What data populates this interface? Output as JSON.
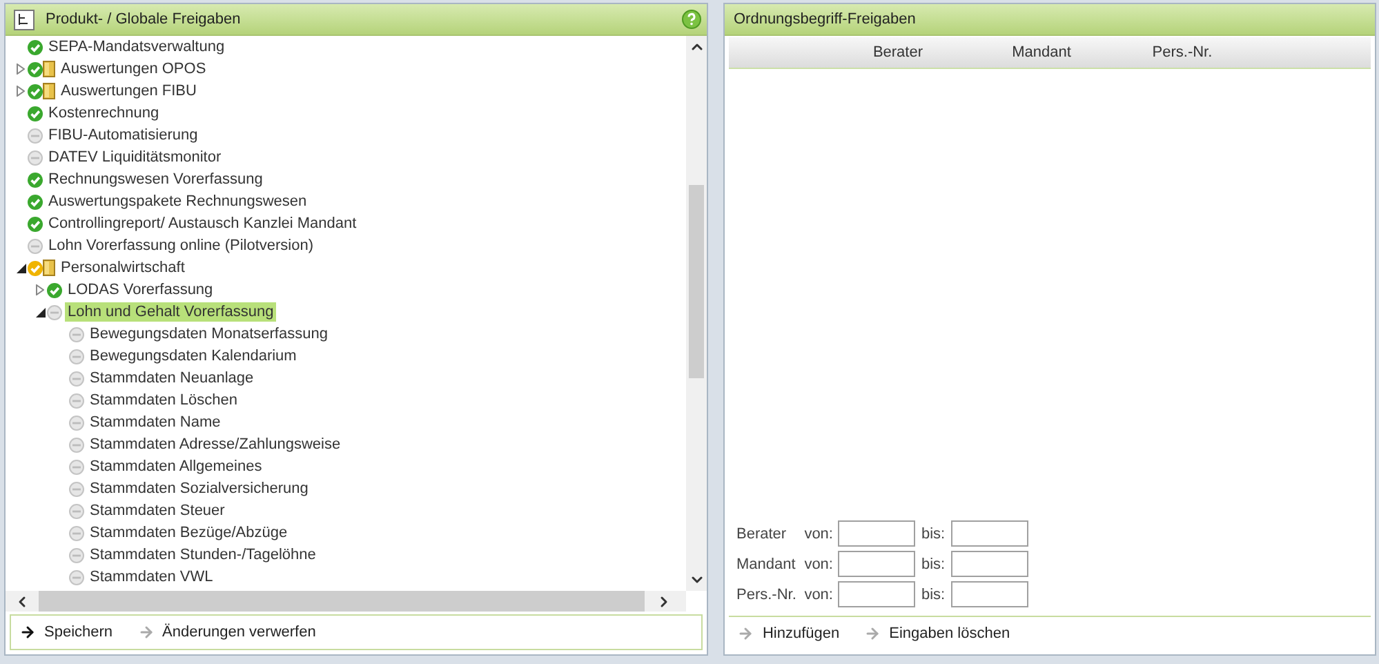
{
  "left_panel": {
    "title": "Produkt- / Globale Freigaben",
    "tree": [
      {
        "label": "SEPA-Mandatsverwaltung",
        "checked": true,
        "partial": false,
        "folder": false,
        "expandable": false,
        "selected": false
      },
      {
        "label": "Auswertungen OPOS",
        "checked": true,
        "partial": false,
        "folder": true,
        "expandable": true,
        "expanded": false,
        "selected": false
      },
      {
        "label": "Auswertungen FIBU",
        "checked": true,
        "partial": false,
        "folder": true,
        "expandable": true,
        "expanded": false,
        "selected": false
      },
      {
        "label": "Kostenrechnung",
        "checked": true,
        "partial": false,
        "folder": false,
        "expandable": false,
        "selected": false
      },
      {
        "label": "FIBU-Automatisierung",
        "checked": false,
        "partial": false,
        "folder": false,
        "expandable": false,
        "selected": false
      },
      {
        "label": "DATEV Liquiditätsmonitor",
        "checked": false,
        "partial": false,
        "folder": false,
        "expandable": false,
        "selected": false
      },
      {
        "label": "Rechnungswesen Vorerfassung",
        "checked": true,
        "partial": false,
        "folder": false,
        "expandable": false,
        "selected": false
      },
      {
        "label": "Auswertungspakete Rechnungswesen",
        "checked": true,
        "partial": false,
        "folder": false,
        "expandable": false,
        "selected": false
      },
      {
        "label": "Controllingreport/ Austausch Kanzlei Mandant",
        "checked": true,
        "partial": false,
        "folder": false,
        "expandable": false,
        "selected": false
      },
      {
        "label": "Lohn Vorerfassung online (Pilotversion)",
        "checked": false,
        "partial": false,
        "folder": false,
        "expandable": false,
        "selected": false
      },
      {
        "label": "Personalwirtschaft",
        "checked": true,
        "partial": true,
        "folder": true,
        "expandable": true,
        "expanded": true,
        "selected": false,
        "children": [
          {
            "label": "LODAS Vorerfassung",
            "checked": true,
            "partial": false,
            "folder": false,
            "expandable": true,
            "expanded": false,
            "selected": false
          },
          {
            "label": "Lohn und Gehalt Vorerfassung",
            "checked": false,
            "partial": false,
            "folder": false,
            "expandable": true,
            "expanded": true,
            "selected": true,
            "children": [
              {
                "label": "Bewegungsdaten Monatserfassung",
                "checked": false,
                "partial": false,
                "folder": false,
                "expandable": false,
                "selected": false
              },
              {
                "label": "Bewegungsdaten Kalendarium",
                "checked": false,
                "partial": false,
                "folder": false,
                "expandable": false,
                "selected": false
              },
              {
                "label": "Stammdaten Neuanlage",
                "checked": false,
                "partial": false,
                "folder": false,
                "expandable": false,
                "selected": false
              },
              {
                "label": "Stammdaten Löschen",
                "checked": false,
                "partial": false,
                "folder": false,
                "expandable": false,
                "selected": false
              },
              {
                "label": "Stammdaten Name",
                "checked": false,
                "partial": false,
                "folder": false,
                "expandable": false,
                "selected": false
              },
              {
                "label": "Stammdaten Adresse/Zahlungsweise",
                "checked": false,
                "partial": false,
                "folder": false,
                "expandable": false,
                "selected": false
              },
              {
                "label": "Stammdaten Allgemeines",
                "checked": false,
                "partial": false,
                "folder": false,
                "expandable": false,
                "selected": false
              },
              {
                "label": "Stammdaten Sozialversicherung",
                "checked": false,
                "partial": false,
                "folder": false,
                "expandable": false,
                "selected": false
              },
              {
                "label": "Stammdaten Steuer",
                "checked": false,
                "partial": false,
                "folder": false,
                "expandable": false,
                "selected": false
              },
              {
                "label": "Stammdaten Bezüge/Abzüge",
                "checked": false,
                "partial": false,
                "folder": false,
                "expandable": false,
                "selected": false
              },
              {
                "label": "Stammdaten Stunden-/Tagelöhne",
                "checked": false,
                "partial": false,
                "folder": false,
                "expandable": false,
                "selected": false
              },
              {
                "label": "Stammdaten VWL",
                "checked": false,
                "partial": false,
                "folder": false,
                "expandable": false,
                "selected": false
              }
            ]
          }
        ]
      }
    ],
    "actions": [
      {
        "label": "Speichern",
        "disabled": false
      },
      {
        "label": "Änderungen verwerfen",
        "disabled": true
      }
    ]
  },
  "right_panel": {
    "title": "Ordnungsbegriff-Freigaben",
    "table": {
      "columns": [
        "Berater",
        "Mandant",
        "Pers.-Nr."
      ]
    },
    "filters": [
      {
        "label": "Berater",
        "from_label": "von:",
        "to_label": "bis:"
      },
      {
        "label": "Mandant",
        "from_label": "von:",
        "to_label": "bis:"
      },
      {
        "label": "Pers.-Nr.",
        "from_label": "von:",
        "to_label": "bis:"
      }
    ],
    "actions": [
      {
        "label": "Hinzufügen",
        "disabled": true
      },
      {
        "label": "Eingaben löschen",
        "disabled": true
      }
    ]
  }
}
